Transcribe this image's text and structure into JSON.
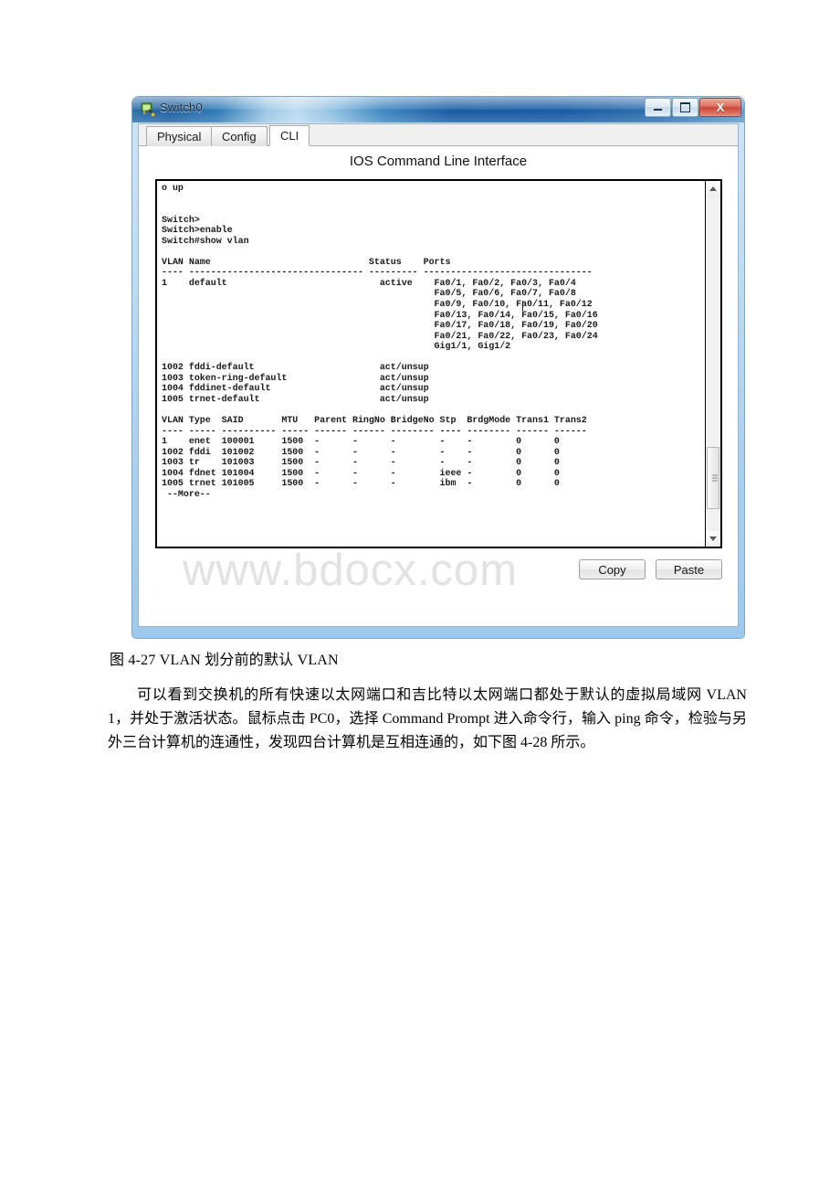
{
  "window": {
    "title": "Switch0",
    "icon": "switch-device-icon",
    "buttons": {
      "minimize": "minimize-icon",
      "maximize": "maximize-icon",
      "close": "X"
    }
  },
  "tabs": [
    {
      "label": "Physical",
      "active": false
    },
    {
      "label": "Config",
      "active": false
    },
    {
      "label": "CLI",
      "active": true
    }
  ],
  "panel": {
    "title": "IOS Command Line Interface",
    "terminal_text": "o up\n\n\nSwitch>\nSwitch>enable\nSwitch#show vlan\n\nVLAN Name                             Status    Ports\n---- -------------------------------- --------- -------------------------------\n1    default                            active    Fa0/1, Fa0/2, Fa0/3, Fa0/4\n                                                  Fa0/5, Fa0/6, Fa0/7, Fa0/8\n                                                  Fa0/9, Fa0/10, Fa0/11, Fa0/12\n                                                  Fa0/13, Fa0/14, Fa0/15, Fa0/16\n                                                  Fa0/17, Fa0/18, Fa0/19, Fa0/20\n                                                  Fa0/21, Fa0/22, Fa0/23, Fa0/24\n                                                  Gig1/1, Gig1/2\n\n1002 fddi-default                       act/unsup\n1003 token-ring-default                 act/unsup\n1004 fddinet-default                    act/unsup\n1005 trnet-default                      act/unsup\n\nVLAN Type  SAID       MTU   Parent RingNo BridgeNo Stp  BrdgMode Trans1 Trans2\n---- ----- ---------- ----- ------ ------ -------- ---- -------- ------ ------\n1    enet  100001     1500  -      -      -        -    -        0      0\n1002 fddi  101002     1500  -      -      -        -    -        0      0\n1003 tr    101003     1500  -      -      -        -    -        0      0\n1004 fdnet 101004     1500  -      -      -        ieee -        0      0\n1005 trnet 101005     1500  -      -      -        ibm  -        0      0\n --More--",
    "copy_label": "Copy",
    "paste_label": "Paste"
  },
  "page": {
    "figure_caption": "图 4-27 VLAN 划分前的默认 VLAN",
    "paragraph": "可以看到交换机的所有快速以太网端口和吉比特以太网端口都处于默认的虚拟局域网 VLAN 1，并处于激活状态。鼠标点击 PC0，选择 Command Prompt 进入命令行，输入 ping 命令，检验与另外三台计算机的连通性，发现四台计算机是互相连通的，如下图 4-28 所示。",
    "watermark": "www.bdocx.com"
  }
}
